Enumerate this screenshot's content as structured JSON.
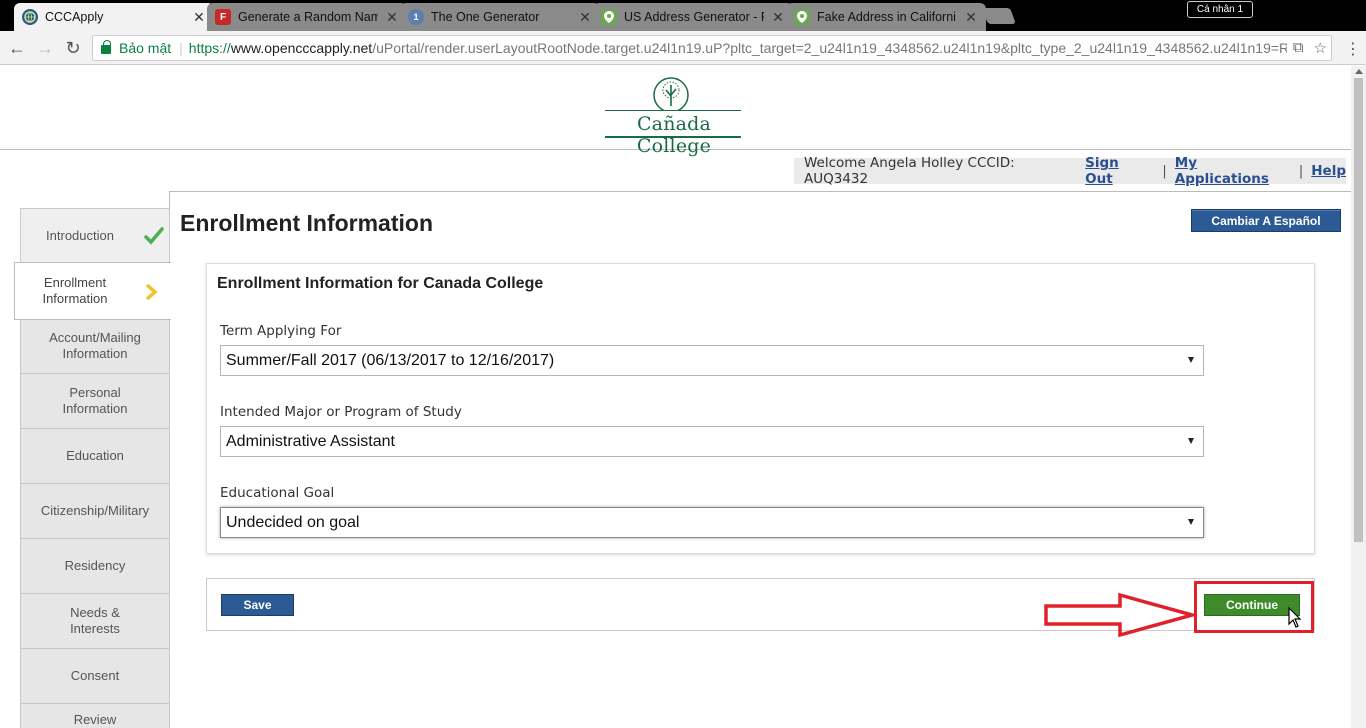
{
  "browser": {
    "tabs": [
      {
        "title": "CCCApply",
        "icon": "globe-icon",
        "active": true
      },
      {
        "title": "Generate a Random Nam",
        "icon": "f-logo-icon",
        "active": false
      },
      {
        "title": "The One Generator",
        "icon": "circle-one-icon",
        "active": false
      },
      {
        "title": "US Address Generator - F",
        "icon": "map-pin-icon",
        "active": false
      },
      {
        "title": "Fake Address in Californi",
        "icon": "map-pin-icon",
        "active": false
      }
    ],
    "profile_label": "Cá nhân 1",
    "secure_label": "Bảo mật",
    "url": {
      "protocol": "https://",
      "host": "www.opencccapply.net",
      "path": "/uPortal/render.userLayoutRootNode.target.u24l1n19.uP?pltc_target=2_u24l1n19_4348562.u24l1n19&pltc_type_2_u24l1n19_4348562.u24l1n19=R"
    }
  },
  "header": {
    "logo_text": "Cañada College",
    "welcome_text": "Welcome Angela Holley CCCID: AUQ3432",
    "sign_out": "Sign Out",
    "my_applications": "My Applications",
    "help": "Help"
  },
  "sidenav": {
    "items": [
      {
        "label": "Introduction",
        "state": "complete"
      },
      {
        "label": "Enrollment Information",
        "state": "current"
      },
      {
        "label": "Account/Mailing Information",
        "state": "pending"
      },
      {
        "label": "Personal Information",
        "state": "pending"
      },
      {
        "label": "Education",
        "state": "pending"
      },
      {
        "label": "Citizenship/Military",
        "state": "pending"
      },
      {
        "label": "Residency",
        "state": "pending"
      },
      {
        "label": "Needs & Interests",
        "state": "pending"
      },
      {
        "label": "Consent",
        "state": "pending"
      },
      {
        "label": "Review",
        "state": "pending"
      }
    ]
  },
  "main": {
    "title": "Enrollment Information",
    "language_button": "Cambiar A Español",
    "form_heading": "Enrollment Information for Canada College",
    "fields": [
      {
        "label": "Term Applying For",
        "value": "Summer/Fall 2017 (06/13/2017 to 12/16/2017)"
      },
      {
        "label": "Intended Major or Program of Study",
        "value": "Administrative Assistant"
      },
      {
        "label": "Educational Goal",
        "value": "Undecided on goal"
      }
    ],
    "save_label": "Save",
    "continue_label": "Continue"
  },
  "colors": {
    "brand_green": "#1a6b45",
    "button_blue": "#2c5a94",
    "continue_green": "#3d8b2a",
    "annotation_red": "#e0202a",
    "check_green": "#4caf50",
    "chevron_yellow": "#f2c230"
  }
}
